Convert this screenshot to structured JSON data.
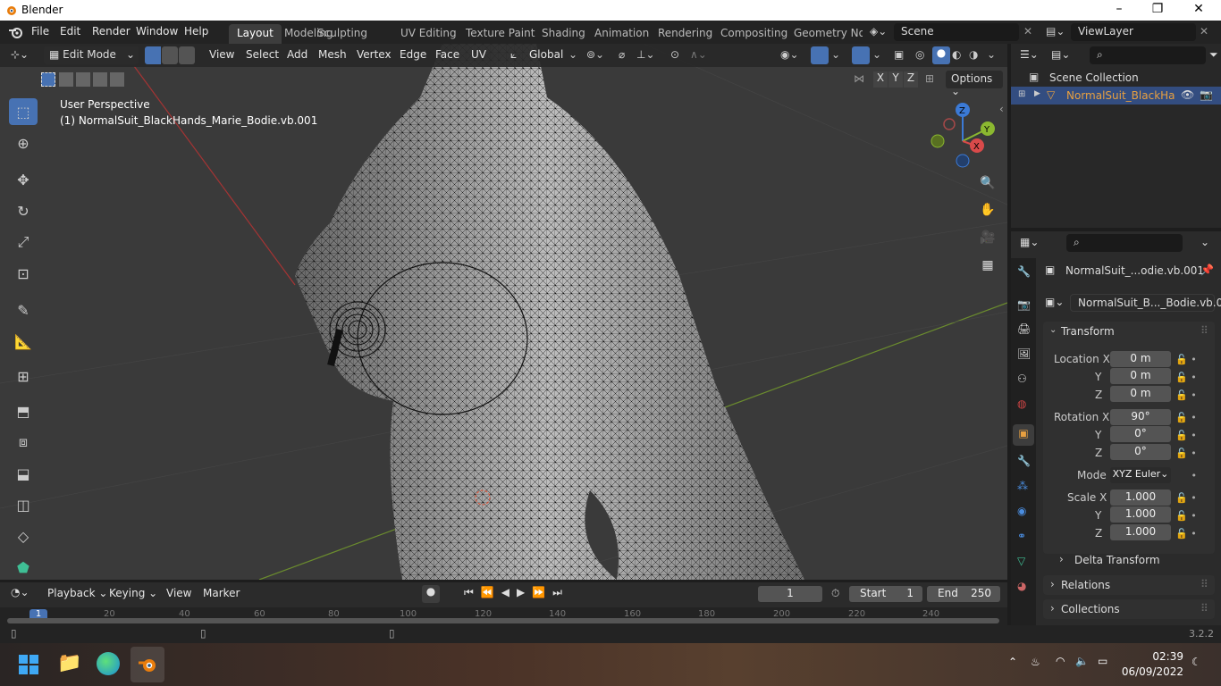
{
  "window": {
    "title": "Blender"
  },
  "menus": [
    "File",
    "Edit",
    "Render",
    "Window",
    "Help"
  ],
  "workspaces": [
    "Layout",
    "Modeling",
    "Sculpting",
    "UV Editing",
    "Texture Paint",
    "Shading",
    "Animation",
    "Rendering",
    "Compositing",
    "Geometry Noc"
  ],
  "scene": "Scene",
  "viewlayer": "ViewLayer",
  "viewport": {
    "mode": "Edit Mode",
    "menus": [
      "View",
      "Select",
      "Add",
      "Mesh",
      "Vertex",
      "Edge",
      "Face",
      "UV"
    ],
    "orientation": "Global",
    "options": "Options",
    "perspective": "User Perspective",
    "object_name": "(1) NormalSuit_BlackHands_Marie_Bodie.vb.001",
    "axes": {
      "x": "X",
      "y": "Y",
      "z": "Z"
    },
    "xyz_toggles": [
      "X",
      "Y",
      "Z"
    ]
  },
  "timeline": {
    "menus": [
      "Playback",
      "Keying",
      "View",
      "Marker"
    ],
    "current_frame": "1",
    "start_label": "Start",
    "start": "1",
    "end_label": "End",
    "end": "250",
    "ticks": [
      "1",
      "20",
      "40",
      "60",
      "80",
      "100",
      "120",
      "140",
      "160",
      "180",
      "200",
      "220",
      "240"
    ]
  },
  "outliner": {
    "collection": "Scene Collection",
    "object": "NormalSuit_BlackHa"
  },
  "properties": {
    "object_short": "NormalSuit_...odie.vb.001",
    "object_field": "NormalSuit_B..._Bodie.vb.001",
    "transform": "Transform",
    "location_label": "Location X",
    "location": [
      "0 m",
      "0 m",
      "0 m"
    ],
    "rotation_label": "Rotation X",
    "rotation": [
      "90°",
      "0°",
      "0°"
    ],
    "y_label": "Y",
    "z_label": "Z",
    "mode_label": "Mode",
    "mode": "XYZ Euler",
    "scale_label": "Scale X",
    "scale": [
      "1.000",
      "1.000",
      "1.000"
    ],
    "delta": "Delta Transform",
    "relations": "Relations",
    "collections": "Collections"
  },
  "status": {
    "version": "3.2.2"
  },
  "taskbar": {
    "time": "02:39",
    "date": "06/09/2022"
  }
}
